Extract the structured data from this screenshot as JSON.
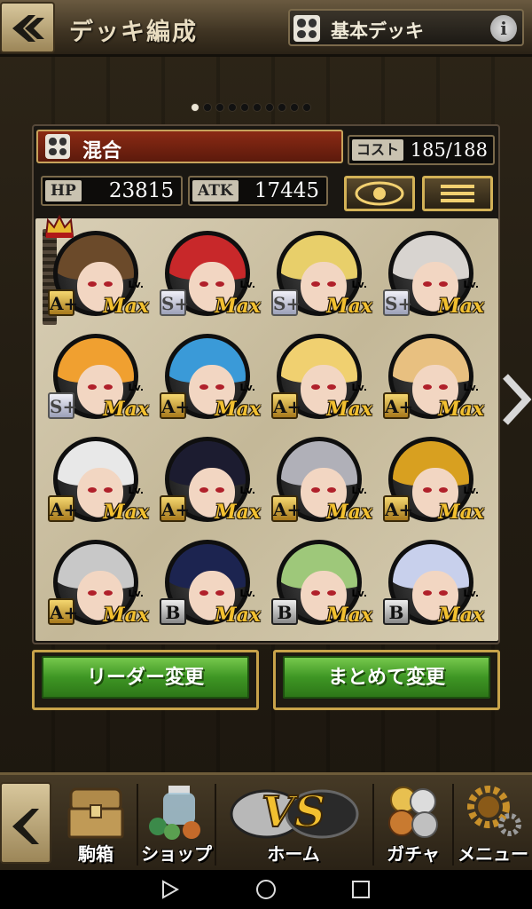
{
  "header": {
    "title": "デッキ編成",
    "deck_name": "基本デッキ",
    "info": "i"
  },
  "pager": {
    "count": 10,
    "active": 0
  },
  "deck": {
    "type_label": "混合",
    "cost_label": "コスト",
    "cost_value": "185/188",
    "hp_label": "HP",
    "hp_value": "23815",
    "atk_label": "ATK",
    "atk_value": "17445"
  },
  "cards": [
    {
      "rank": "A+",
      "rank_style": "gold",
      "hair": "#6b4a2a",
      "leader": true
    },
    {
      "rank": "S+",
      "rank_style": "silver",
      "hair": "#c8282a"
    },
    {
      "rank": "S+",
      "rank_style": "silver",
      "hair": "#e8cf6a"
    },
    {
      "rank": "S+",
      "rank_style": "silver",
      "hair": "#d8d4d0"
    },
    {
      "rank": "S+",
      "rank_style": "silver",
      "hair": "#f0a030"
    },
    {
      "rank": "A+",
      "rank_style": "gold",
      "hair": "#3a9ad8"
    },
    {
      "rank": "A+",
      "rank_style": "gold",
      "hair": "#f0d070"
    },
    {
      "rank": "A+",
      "rank_style": "gold",
      "hair": "#e8c080"
    },
    {
      "rank": "A+",
      "rank_style": "gold",
      "hair": "#e8e8e8"
    },
    {
      "rank": "A+",
      "rank_style": "gold",
      "hair": "#1c1c30"
    },
    {
      "rank": "A+",
      "rank_style": "gold",
      "hair": "#b0b0b8"
    },
    {
      "rank": "A+",
      "rank_style": "gold",
      "hair": "#d8a020"
    },
    {
      "rank": "A+",
      "rank_style": "gold",
      "hair": "#c8c8c8"
    },
    {
      "rank": "B",
      "rank_style": "dark",
      "hair": "#1c2450"
    },
    {
      "rank": "B",
      "rank_style": "dark",
      "hair": "#9ec87a"
    },
    {
      "rank": "B",
      "rank_style": "dark",
      "hair": "#c8d0ec"
    }
  ],
  "card_labels": {
    "lv": "Lv.",
    "max": "Max"
  },
  "actions": {
    "leader_change": "リーダー変更",
    "bulk_change": "まとめて変更"
  },
  "nav": {
    "box": "駒箱",
    "shop": "ショップ",
    "home": "ホーム",
    "gacha": "ガチャ",
    "menu": "メニュー",
    "vs_logo": "VS"
  },
  "colors": {
    "gold": "#d3b257",
    "green": "#3e9624",
    "panel_red": "#8b2a14"
  }
}
